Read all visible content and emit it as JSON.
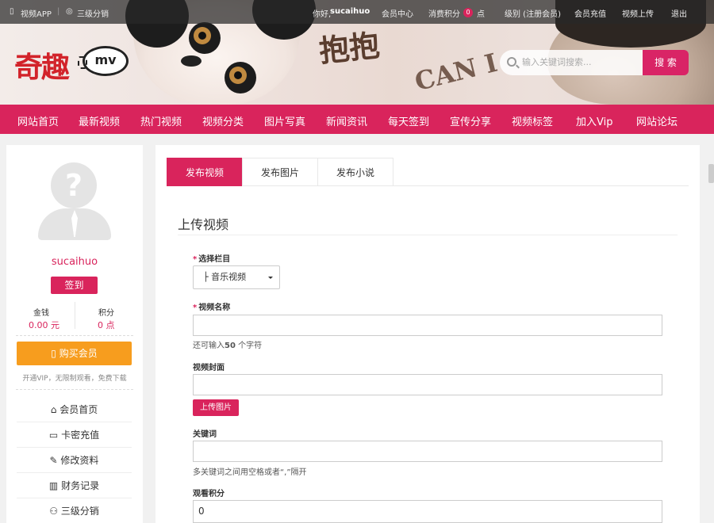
{
  "topbar": {
    "app_link": "视频APP",
    "distribution_link": "三级分销",
    "greeting": "你好,",
    "username": "sucaihuo",
    "member_center": "会员中心",
    "points_label": "消费积分",
    "points_value": "0",
    "points_unit": "点",
    "level": "级别 (注册会员)",
    "recharge": "会员充值",
    "upload_video": "视频上传",
    "logout": "退出"
  },
  "logo": {
    "cn": "奇趣",
    "mv": "mv"
  },
  "banner_art": {
    "text1": "抱抱",
    "text2": "CAN I"
  },
  "search": {
    "placeholder": "输入关键词搜索...",
    "button": "搜 索"
  },
  "nav": [
    "网站首页",
    "最新视频",
    "热门视频",
    "视频分类",
    "图片写真",
    "新闻资讯",
    "每天签到",
    "宣传分享",
    "视频标签",
    "加入Vip",
    "网站论坛"
  ],
  "sidebar": {
    "username": "sucaihuo",
    "sign_button": "签到",
    "money_label": "金钱",
    "money_value": "0.00 元",
    "points_label": "积分",
    "points_value": "0 点",
    "buy_button": "购买会员",
    "vip_note": "开通VIP，无限制观看，免费下载",
    "menu": [
      "会员首页",
      "卡密充值",
      "修改资料",
      "财务记录",
      "三级分销"
    ]
  },
  "main": {
    "tabs": [
      "发布视频",
      "发布图片",
      "发布小说"
    ],
    "section_title": "上传视频",
    "category_label": "选择栏目",
    "category_value": "├ 音乐视频",
    "name_label": "视频名称",
    "name_hint_prefix": "还可输入",
    "name_hint_count": "50",
    "name_hint_suffix": "个字符",
    "cover_label": "视频封面",
    "upload_button": "上传图片",
    "keywords_label": "关键词",
    "keywords_hint": "多关键词之间用空格或者“,”隔开",
    "points_label": "观看积分",
    "points_value": "0"
  },
  "colors": {
    "accent": "#d9245c",
    "orange": "#f79d1e"
  }
}
